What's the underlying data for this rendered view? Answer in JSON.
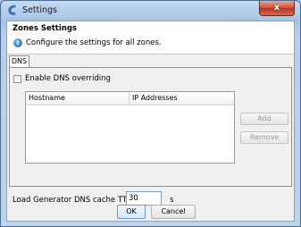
{
  "window": {
    "title": "Settings",
    "close_symbol": "x"
  },
  "header": {
    "title": "Zones Settings",
    "description": "Configure the settings for all zones."
  },
  "tabs": [
    {
      "label": "DNS",
      "selected": true
    }
  ],
  "dns": {
    "enable_override_label": "Enable DNS overriding",
    "enable_override_checked": false,
    "table": {
      "columns": [
        "Hostname",
        "IP Addresses"
      ],
      "rows": []
    },
    "add_label": "Add",
    "remove_label": "Remove"
  },
  "cache_ttl": {
    "label": "Load Generator DNS cache TTL",
    "value": "30",
    "unit": "s"
  },
  "footer": {
    "ok_label": "OK",
    "cancel_label": "Cancel"
  },
  "colors": {
    "title_gradient": "#a7c3e3",
    "close": "#c9503a",
    "panel": "#f0f0f0"
  }
}
